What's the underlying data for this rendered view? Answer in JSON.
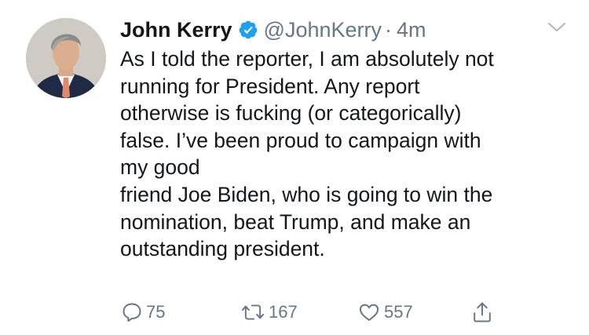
{
  "tweet": {
    "author_name": "John Kerry",
    "handle": "@JohnKerry",
    "separator": "·",
    "time": "4m",
    "body_lines": [
      "As I told the reporter, I am absolutely not",
      "running for President. Any report",
      "otherwise is fucking (or categorically)",
      "false. I’ve been proud to campaign with",
      "my good",
      "friend Joe Biden, who is going to win the",
      "nomination, beat Trump, and make an",
      "outstanding president."
    ]
  },
  "actions": {
    "replies": "75",
    "retweets": "167",
    "likes": "557"
  },
  "icons": {
    "verified": "verified-badge-icon",
    "caret": "chevron-down-icon",
    "reply": "reply-bubble-icon",
    "retweet": "retweet-icon",
    "like": "heart-icon",
    "share": "share-upload-icon"
  },
  "colors": {
    "text": "#14171a",
    "muted": "#657786",
    "verified_blue": "#1da1f2"
  }
}
